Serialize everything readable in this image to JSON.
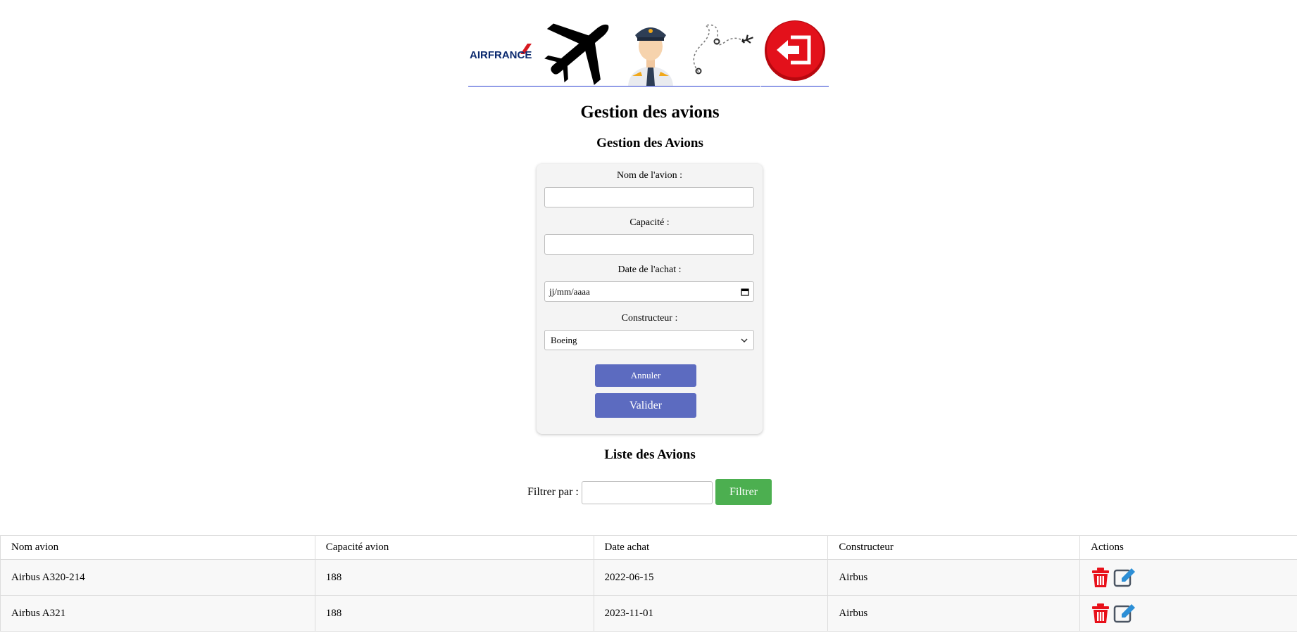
{
  "nav": {
    "logo_text": "AIRFRANCE"
  },
  "page_title": "Gestion des avions",
  "form": {
    "heading": "Gestion des Avions",
    "nom_label": "Nom de l'avion :",
    "nom_value": "",
    "capacite_label": "Capacité :",
    "capacite_value": "",
    "date_label": "Date de l'achat :",
    "date_placeholder": "jj/mm/aaaa",
    "constructeur_label": "Constructeur :",
    "constructeur_selected": "Boeing",
    "annuler_label": "Annuler",
    "valider_label": "Valider"
  },
  "list": {
    "heading": "Liste des Avions",
    "filter_label": "Filtrer par :",
    "filter_value": "",
    "filter_button": "Filtrer",
    "columns": [
      "Nom avion",
      "Capacité avion",
      "Date achat",
      "Constructeur",
      "Actions"
    ],
    "rows": [
      {
        "nom": "Airbus A320-214",
        "capacite": "188",
        "date": "2022-06-15",
        "constructeur": "Airbus"
      },
      {
        "nom": "Airbus A321",
        "capacite": "188",
        "date": "2023-11-01",
        "constructeur": "Airbus"
      }
    ]
  },
  "icons": {
    "nav": [
      "airfrance-logo-icon",
      "airplane-icon",
      "pilot-icon",
      "flight-route-icon",
      "logout-icon"
    ],
    "row_actions": [
      "trash-icon",
      "edit-icon"
    ]
  },
  "colors": {
    "primary_button": "#5c6bc0",
    "filter_button": "#4caf50",
    "delete": "#e8101a",
    "edit": "#2d8fd6",
    "logout": "#e3111b"
  }
}
